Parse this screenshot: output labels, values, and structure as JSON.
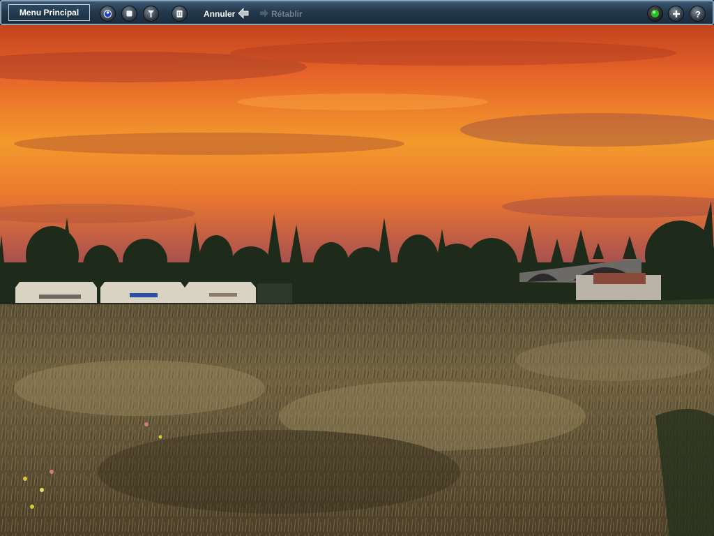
{
  "toolbar": {
    "menu_label": "Menu Principal",
    "undo_label": "Annuler",
    "redo_label": "Rétablir",
    "left_icons": [
      "driver-icon",
      "stop-icon",
      "tools-icon",
      "delete-icon"
    ],
    "right_icons": [
      "status-light-icon",
      "add-icon",
      "help-icon"
    ]
  },
  "scene": {
    "colors": {
      "sky_top": "#c8461f",
      "sky_mid": "#f08a2a",
      "sky_low": "#e07230",
      "horizon_purple": "#8a4a5a",
      "tree_dark": "#1d2a1a",
      "field": "#6a5a3a",
      "status_green": "#2ecc2e"
    }
  }
}
